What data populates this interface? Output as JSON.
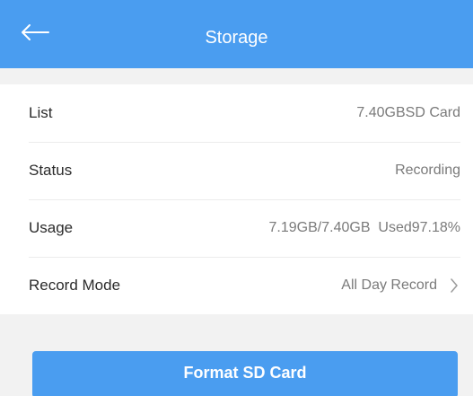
{
  "header": {
    "title": "Storage",
    "back_icon": "arrow-left-icon"
  },
  "storage": {
    "rows": [
      {
        "label": "List",
        "value": "7.40GBSD Card"
      },
      {
        "label": "Status",
        "value": "Recording"
      },
      {
        "label": "Usage",
        "value": "7.19GB/7.40GB  Used97.18%"
      },
      {
        "label": "Record Mode",
        "value": "All Day Record",
        "icon": "chevron-right-icon"
      }
    ]
  },
  "actions": {
    "format_label": "Format SD Card"
  },
  "colors": {
    "accent": "#4a9df0",
    "background": "#f2f2f2",
    "card": "#ffffff",
    "label": "#2b2b2b",
    "value": "#7a7a7a"
  }
}
